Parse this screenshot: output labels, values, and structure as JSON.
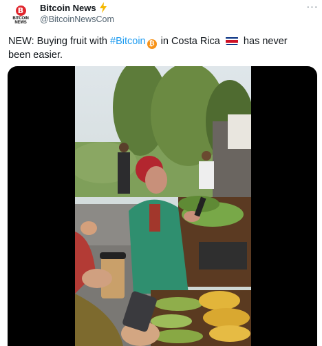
{
  "author": {
    "display_name": "Bitcoin News",
    "handle": "@BitcoinNewsCom",
    "avatar_symbol": "B",
    "avatar_wordmark": "BITCOIN NEWS"
  },
  "tweet": {
    "prefix": "NEW: Buying fruit with ",
    "hashtag": "#Bitcoin",
    "middle": " in Costa Rica ",
    "suffix": " has never been easier."
  },
  "icons": {
    "verified": "lightning-bolt-icon",
    "more": "more-options-icon",
    "bitcoin": "bitcoin-icon",
    "flag": "costa-rica-flag-icon"
  },
  "colors": {
    "hashtag": "#1d9bf0",
    "handle": "#536471",
    "bolt": "#f5b800",
    "bitcoin": "#f7931a",
    "avatar_accent": "#e0262d"
  },
  "media": {
    "type": "video",
    "subject": "video-thumbnail"
  }
}
